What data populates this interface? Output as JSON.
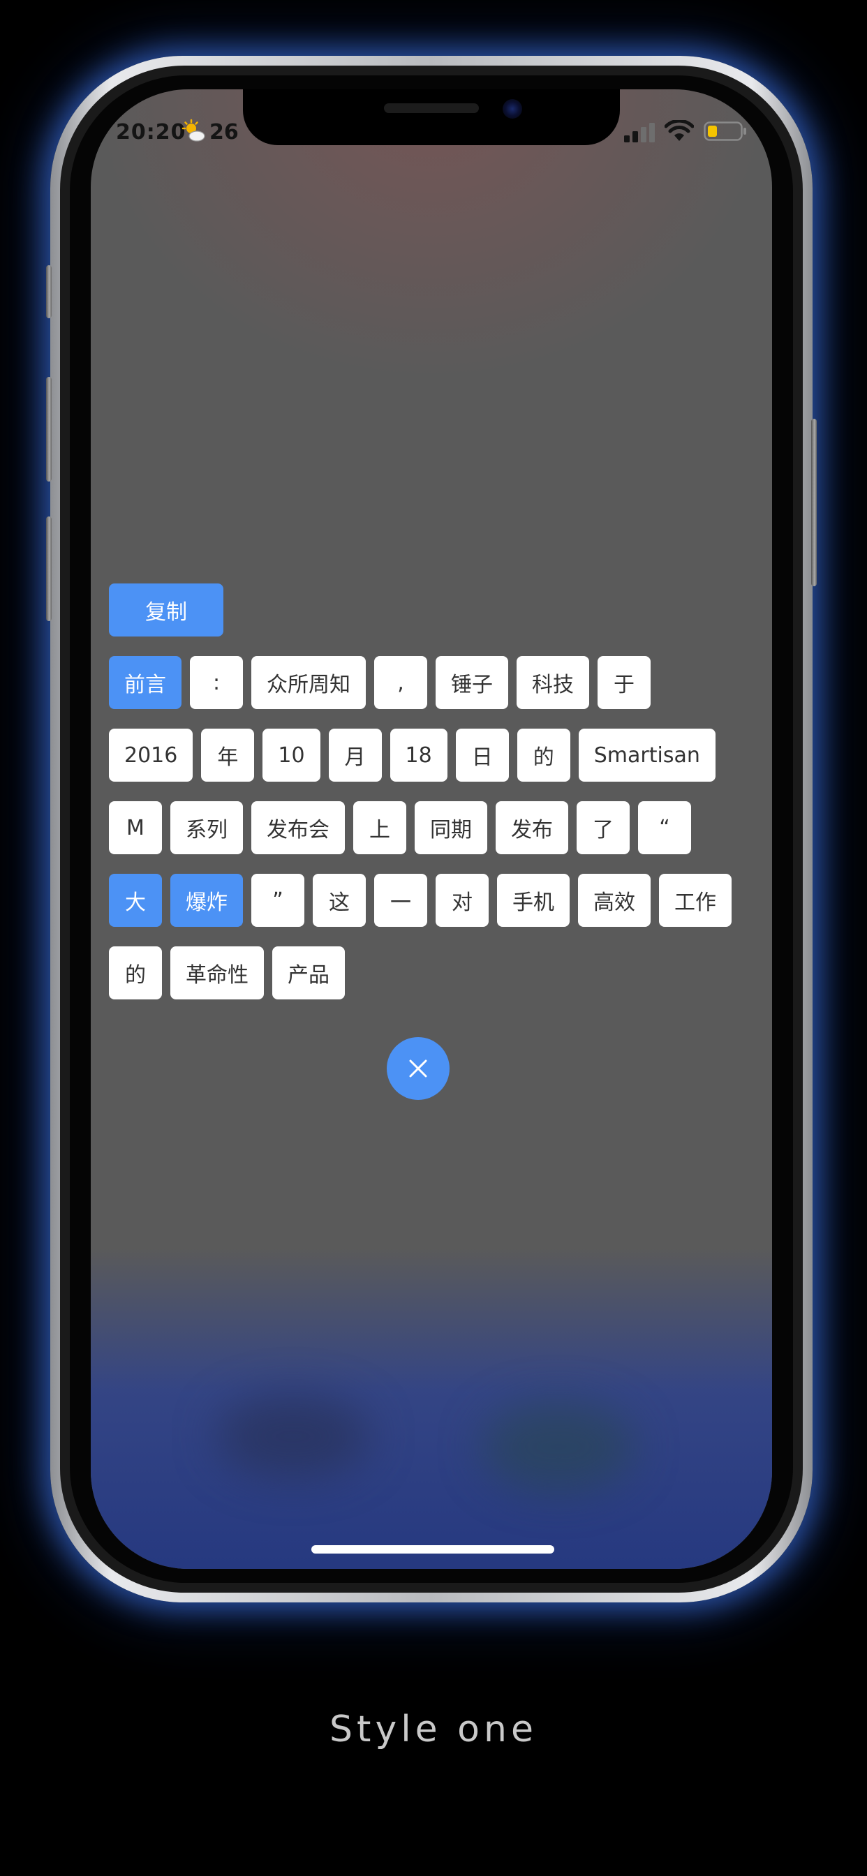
{
  "status_bar": {
    "time": "20:20",
    "weather_icon": "partly-sunny-icon",
    "temperature": "26",
    "signal_icon": "cellular-signal-icon",
    "wifi_icon": "wifi-icon",
    "battery_icon": "battery-low-icon",
    "battery_color": "#f5c400"
  },
  "copy_label": "复制",
  "tokens": {
    "rows": [
      [
        {
          "text": "前言",
          "selected": true
        },
        {
          "text": ":",
          "selected": false
        },
        {
          "text": "众所周知",
          "selected": false
        },
        {
          "text": ",",
          "selected": false
        },
        {
          "text": "锤子",
          "selected": false
        },
        {
          "text": "科技",
          "selected": false
        },
        {
          "text": "于",
          "selected": false
        }
      ],
      [
        {
          "text": "2016",
          "selected": false
        },
        {
          "text": "年",
          "selected": false
        },
        {
          "text": "10",
          "selected": false
        },
        {
          "text": "月",
          "selected": false
        },
        {
          "text": "18",
          "selected": false
        },
        {
          "text": "日",
          "selected": false
        },
        {
          "text": "的",
          "selected": false
        },
        {
          "text": "Smartisan",
          "selected": false
        }
      ],
      [
        {
          "text": "M",
          "selected": false
        },
        {
          "text": "系列",
          "selected": false
        },
        {
          "text": "发布会",
          "selected": false
        },
        {
          "text": "上",
          "selected": false
        },
        {
          "text": "同期",
          "selected": false
        },
        {
          "text": "发布",
          "selected": false
        },
        {
          "text": "了",
          "selected": false
        },
        {
          "text": "“",
          "selected": false
        }
      ],
      [
        {
          "text": "大",
          "selected": true
        },
        {
          "text": "爆炸",
          "selected": true
        },
        {
          "text": "”",
          "selected": false
        },
        {
          "text": "这",
          "selected": false
        },
        {
          "text": "一",
          "selected": false
        },
        {
          "text": "对",
          "selected": false
        },
        {
          "text": "手机",
          "selected": false
        },
        {
          "text": "高效",
          "selected": false
        },
        {
          "text": "工作",
          "selected": false
        }
      ],
      [
        {
          "text": "的",
          "selected": false
        },
        {
          "text": "革命性",
          "selected": false
        },
        {
          "text": "产品",
          "selected": false
        }
      ]
    ]
  },
  "close_icon": "close-icon",
  "caption": "Style one",
  "colors": {
    "accent": "#4c92f5",
    "token_bg": "#ffffff",
    "token_text": "#333333",
    "overlay": "#5a5a5a",
    "glow": "#4682ff"
  }
}
